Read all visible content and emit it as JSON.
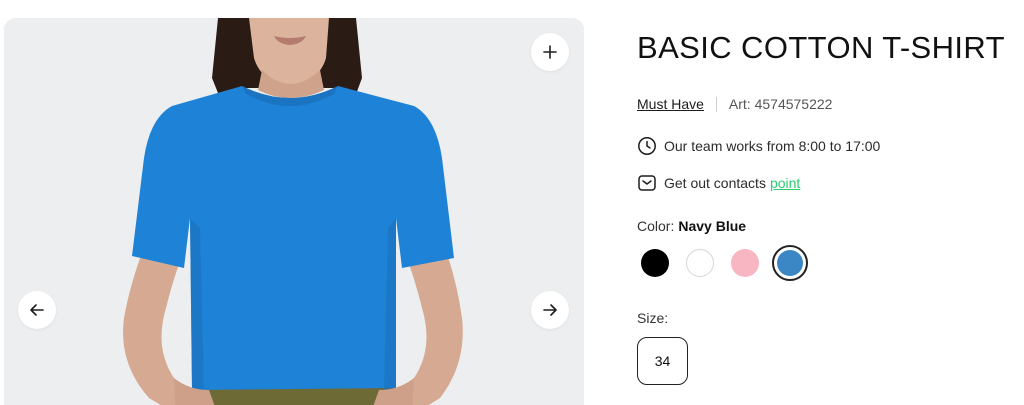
{
  "gallery": {
    "zoom_icon": "plus-icon",
    "prev_icon": "arrow-left-icon",
    "next_icon": "arrow-right-icon",
    "shirt_color": "#1e82d6"
  },
  "product": {
    "title": "BASIC COTTON T-SHIRT",
    "brand": "Must Have",
    "article": "Art: 4574575222",
    "hours_text": "Our team works from 8:00 to 17:00",
    "hours_icon": "clock-icon",
    "contacts_text": "Get out contacts",
    "contacts_link": "point",
    "contacts_icon": "mail-icon",
    "link_color": "#2ecc71"
  },
  "color": {
    "label": "Color:",
    "selected": "Navy Blue",
    "swatches": [
      {
        "color": "#000000",
        "selected": false
      },
      {
        "color": "#ffffff",
        "selected": false
      },
      {
        "color": "#f7b6c2",
        "selected": false
      },
      {
        "color": "#3b86c4",
        "selected": true
      }
    ]
  },
  "size": {
    "label": "Size:",
    "selected": "34"
  }
}
